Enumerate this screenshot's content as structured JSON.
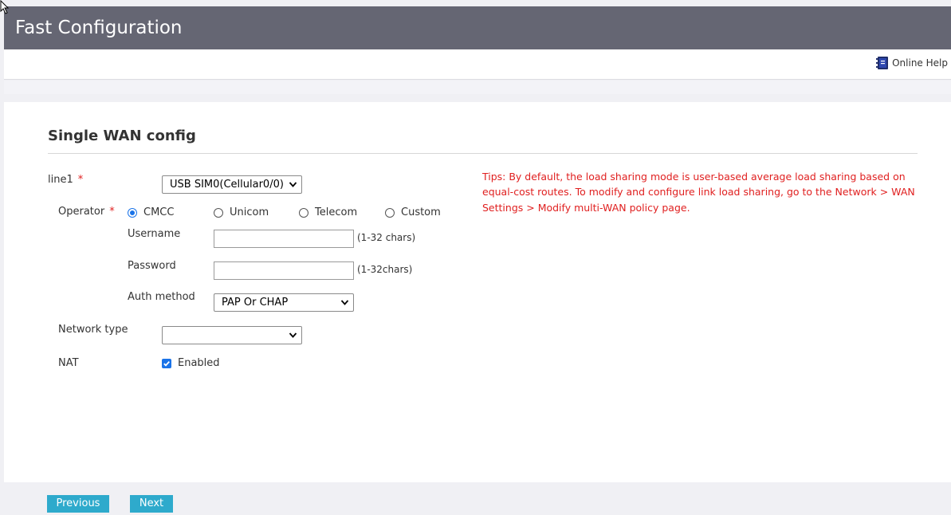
{
  "header": {
    "title": "Fast Configuration",
    "online_help": "Online Help"
  },
  "section": {
    "title": "Single WAN config"
  },
  "form": {
    "line1": {
      "label": "line1",
      "required_mark": "*",
      "value": "USB SIM0(Cellular0/0)"
    },
    "operator": {
      "label": "Operator",
      "required_mark": "*",
      "options": [
        {
          "label": "CMCC",
          "selected": true
        },
        {
          "label": "Unicom",
          "selected": false
        },
        {
          "label": "Telecom",
          "selected": false
        },
        {
          "label": "Custom",
          "selected": false
        }
      ]
    },
    "username": {
      "label": "Username",
      "value": "",
      "hint": "(1-32 chars)"
    },
    "password": {
      "label": "Password",
      "value": "",
      "hint": "(1-32chars)"
    },
    "auth_method": {
      "label": "Auth method",
      "value": "PAP Or CHAP"
    },
    "network_type": {
      "label": "Network type",
      "value": ""
    },
    "nat": {
      "label": "NAT",
      "checkbox_label": "Enabled",
      "checked": true
    }
  },
  "tips": "Tips: By default, the load sharing mode is user-based average load sharing based on equal-cost routes. To modify and configure link load sharing, go to the Network > WAN Settings > Modify multi-WAN policy page.",
  "footer": {
    "previous_label": "Previous",
    "next_label": "Next"
  },
  "colors": {
    "titlebar": "#656673",
    "accent": "#1a73e8",
    "button": "#2eaacc",
    "tips_text": "#e02020"
  }
}
